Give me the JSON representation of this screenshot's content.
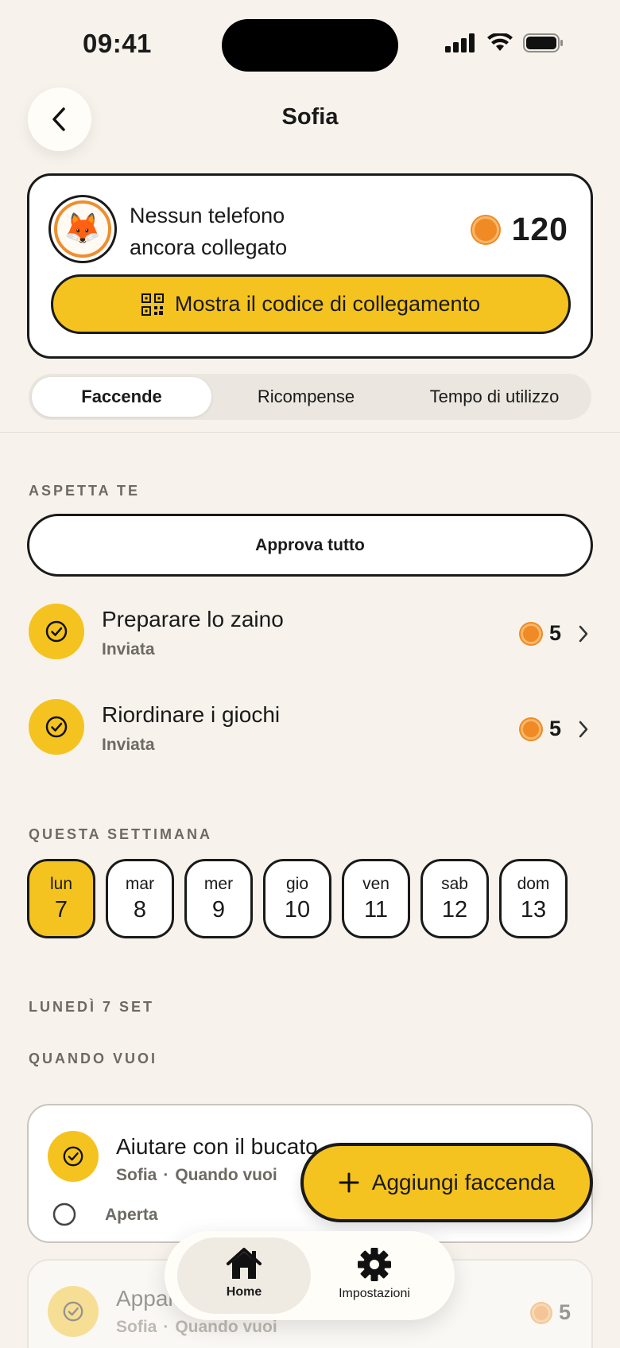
{
  "status_bar": {
    "time": "09:41"
  },
  "header": {
    "title": "Sofia",
    "back_icon": "chevron-left-icon"
  },
  "profile": {
    "avatar_emoji": "🦊",
    "phone_status_line1": "Nessun telefono",
    "phone_status_line2": "ancora collegato",
    "coins": "120",
    "link_button_label": "Mostra il codice di collegamento"
  },
  "tabs": [
    {
      "label": "Faccende",
      "active": true
    },
    {
      "label": "Ricompense",
      "active": false
    },
    {
      "label": "Tempo di utilizzo",
      "active": false
    }
  ],
  "pending": {
    "section_label": "ASPETTA TE",
    "approve_all_label": "Approva tutto",
    "items": [
      {
        "title": "Preparare lo zaino",
        "status": "Inviata",
        "reward": "5"
      },
      {
        "title": "Riordinare i giochi",
        "status": "Inviata",
        "reward": "5"
      }
    ]
  },
  "week": {
    "section_label": "QUESTA SETTIMANA",
    "days": [
      {
        "name": "lun",
        "num": "7",
        "active": true
      },
      {
        "name": "mar",
        "num": "8"
      },
      {
        "name": "mer",
        "num": "9"
      },
      {
        "name": "gio",
        "num": "10"
      },
      {
        "name": "ven",
        "num": "11"
      },
      {
        "name": "sab",
        "num": "12"
      },
      {
        "name": "dom",
        "num": "13"
      }
    ]
  },
  "day_section": {
    "date_label": "LUNEDÌ 7 SET",
    "when_label": "QUANDO VUOI"
  },
  "task_cards": [
    {
      "title": "Aiutare con il bucato",
      "assignee": "Sofia",
      "sep": "·",
      "schedule": "Quando vuoi",
      "state": "Aperta"
    },
    {
      "title": "Apparecchiare",
      "assignee": "Sofia",
      "sep": "·",
      "schedule": "Quando vuoi",
      "reward": "5"
    }
  ],
  "fab": {
    "label": "Aggiungi faccenda",
    "icon": "plus-icon"
  },
  "tabbar": {
    "home_label": "Home",
    "settings_label": "Impostazioni"
  },
  "colors": {
    "accent": "#f5c31f",
    "coin": "#f08a24",
    "background": "#f7f3ec"
  }
}
